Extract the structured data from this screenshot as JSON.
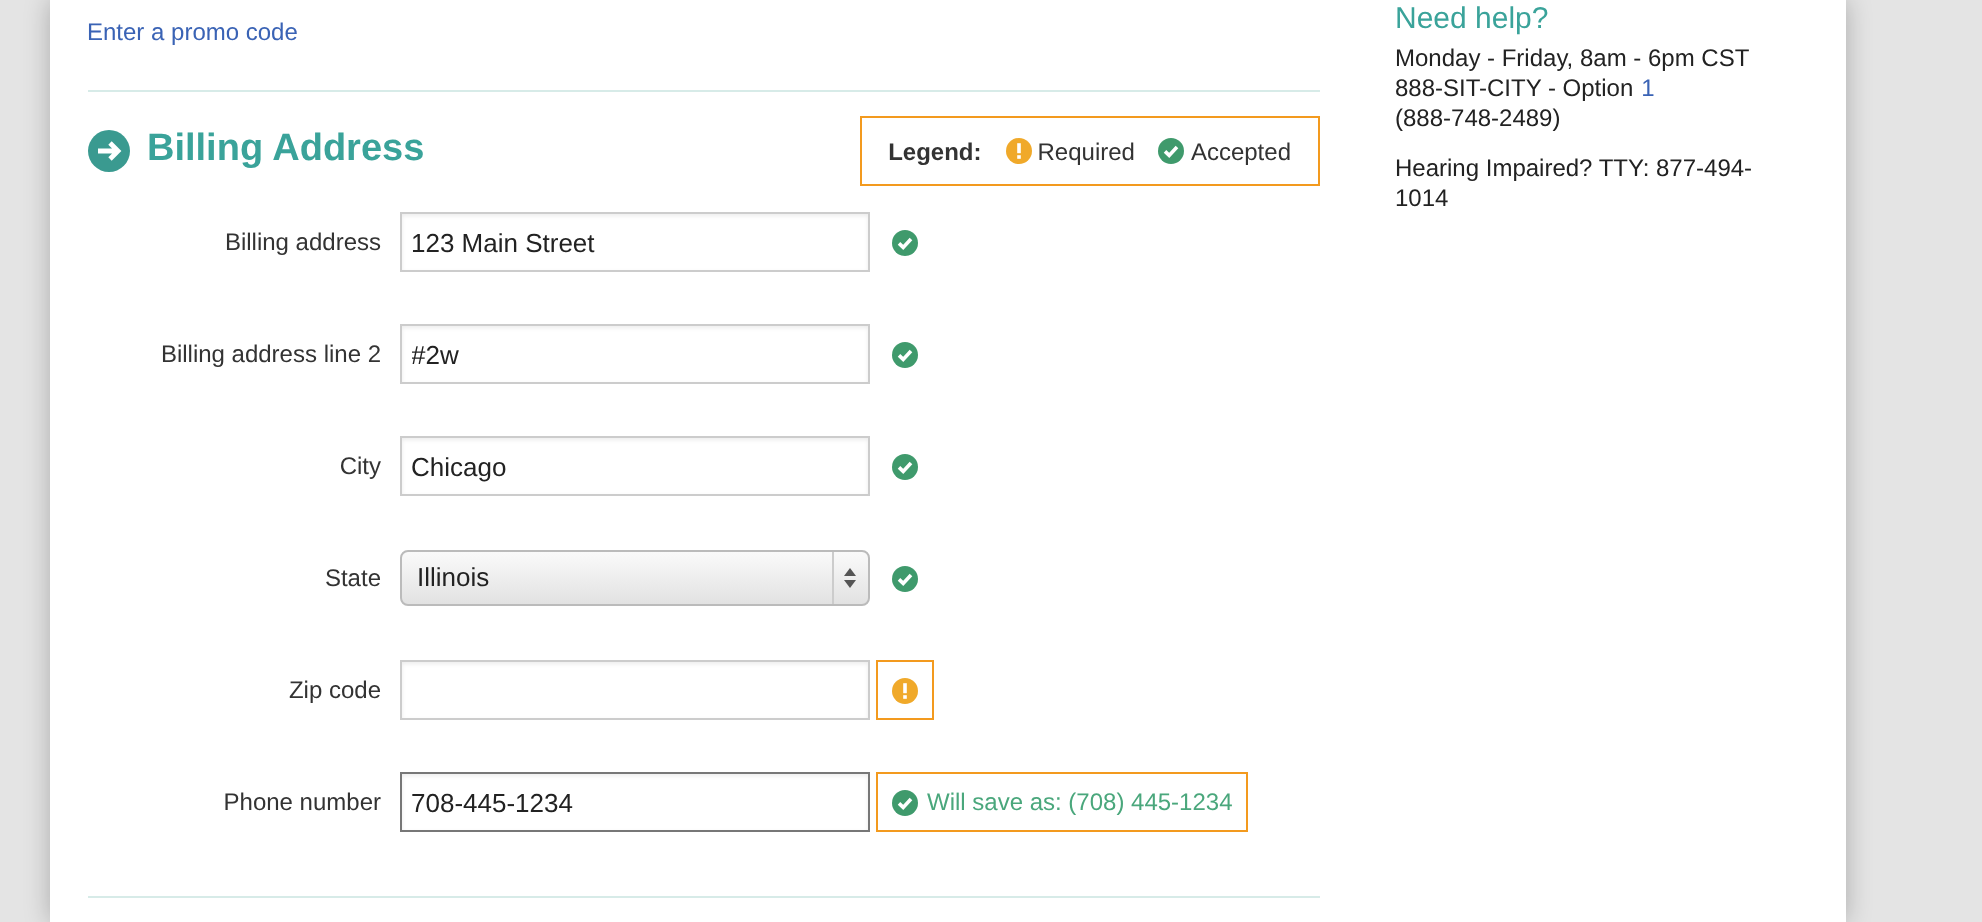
{
  "promo_link": "Enter a promo code",
  "section": {
    "title": "Billing Address"
  },
  "legend": {
    "label": "Legend:",
    "items": [
      {
        "kind": "required",
        "text": "Required"
      },
      {
        "kind": "accepted",
        "text": "Accepted"
      }
    ]
  },
  "fields": [
    {
      "label": "Billing address",
      "kind": "text",
      "value": "123 Main Street",
      "valid": true,
      "focused": false,
      "highlighted": false
    },
    {
      "label": "Billing address line 2",
      "kind": "text",
      "value": "#2w",
      "valid": true,
      "focused": false,
      "highlighted": false
    },
    {
      "label": "City",
      "kind": "text",
      "value": "Chicago",
      "valid": true,
      "focused": false,
      "highlighted": false
    },
    {
      "label": "State",
      "kind": "select",
      "value": "Illinois",
      "valid": true,
      "focused": false,
      "highlighted": false
    },
    {
      "label": "Zip code",
      "kind": "text",
      "valid": false,
      "focused": false,
      "highlighted": true
    },
    {
      "label": "Phone number",
      "kind": "text",
      "value": "708-445-1234",
      "valid": true,
      "focused": true,
      "highlighted": true,
      "message": "Will save as: (708) 445-1234"
    }
  ],
  "help": {
    "title": "Need help?",
    "lines": [
      {
        "text": "Monday - Friday, 8am - 6pm CST"
      },
      {
        "text": "888-SIT-CITY - Option",
        "link": "1"
      },
      {
        "text": "(888-748-2489)"
      }
    ],
    "note": "Hearing Impaired? TTY: 877-494-1014"
  }
}
